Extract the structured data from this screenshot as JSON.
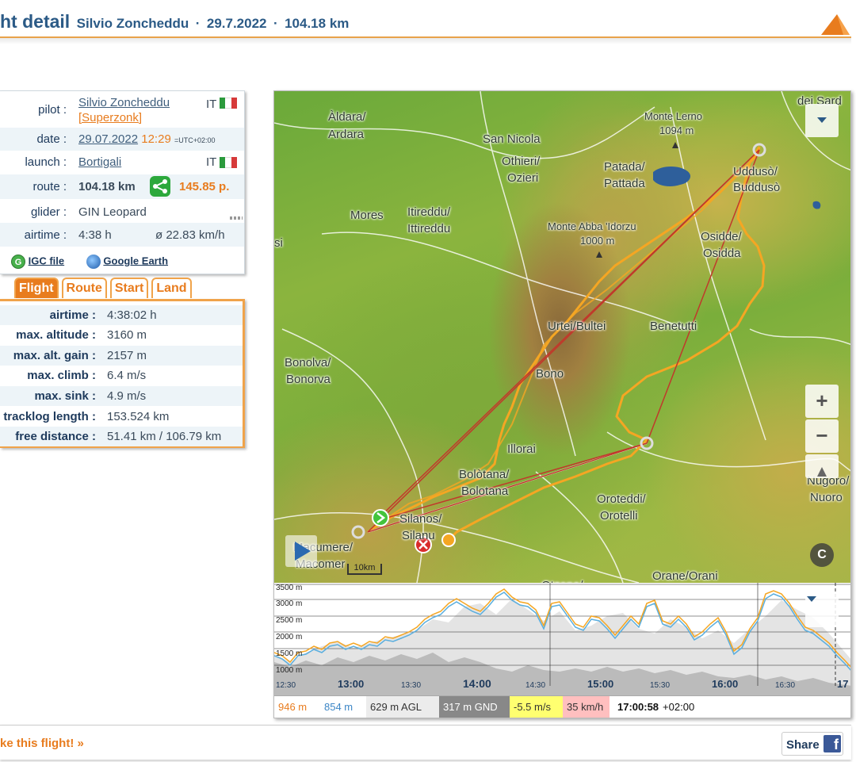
{
  "header": {
    "title": "ht detail",
    "pilot": "Silvio Zoncheddu",
    "date": "29.7.2022",
    "distance": "104.18 km",
    "sep": "·"
  },
  "info": {
    "pilot_label": "pilot :",
    "pilot_name": "Silvio Zoncheddu",
    "pilot_nick": "[Superzonk]",
    "country_code": "IT",
    "date_label": "date :",
    "date_value": "29.07.2022",
    "time_value": "12:29",
    "utc": "=UTC+02:00",
    "launch_label": "launch :",
    "launch_value": "Bortigali",
    "route_label": "route :",
    "route_km": "104.18 km",
    "route_points": "145.85 p.",
    "glider_label": "glider :",
    "glider_value": "GIN Leopard",
    "airtime_label": "airtime :",
    "airtime_value": "4:38 h",
    "avg_speed": "ø 22.83 km/h",
    "igc_file": "IGC file",
    "igc_icon": "G",
    "google_earth": "Google Earth"
  },
  "tabs": [
    "Flight",
    "Route",
    "Start",
    "Land"
  ],
  "stats": [
    {
      "label": "airtime :",
      "value": "4:38:02 h"
    },
    {
      "label": "max. altitude :",
      "value": "3160 m"
    },
    {
      "label": "max. alt. gain :",
      "value": "2157 m"
    },
    {
      "label": "max. climb :",
      "value": "6.4 m/s"
    },
    {
      "label": "max. sink :",
      "value": "4.9 m/s"
    },
    {
      "label": "tracklog length :",
      "value": "153.524 km"
    },
    {
      "label": "free distance :",
      "value": "51.41 km / 106.79 km"
    }
  ],
  "map": {
    "places": [
      "Àldara/",
      "Ardara",
      "San Nicola",
      "Monte Lerno",
      "1094 m",
      "dei Sard",
      "Othieri/",
      "Ozieri",
      "Patada/",
      "Pattada",
      "Uddusò/",
      "Buddusò",
      "Mores",
      "Itireddu/",
      "Ittireddu",
      "Monte Abba 'Idorzu",
      "1000 m",
      "Osidde/",
      "Osidda",
      "si",
      "Urtei/Bultei",
      "Benetutti",
      "Bonolva/",
      "Bonorva",
      "Bono",
      "Illorai",
      "Bolòtana/",
      "Bolotana",
      "Nùgoro/",
      "Nuoro",
      "Silanos/",
      "Silanu",
      "Oroteddi/",
      "Orotelli",
      "Macumere/",
      "Macomer",
      "Orane/Orani",
      "Otzana/"
    ],
    "scale": "10km",
    "zoom_in": "+",
    "zoom_out": "−",
    "copyright": "C"
  },
  "barogram": {
    "y_ticks": [
      "3500 m",
      "3000 m",
      "2500 m",
      "2000 m",
      "1500 m",
      "1000 m"
    ],
    "x_ticks": [
      "12:30",
      "13:00",
      "13:30",
      "14:00",
      "14:30",
      "15:00",
      "15:30",
      "16:00",
      "16:30",
      "17"
    ]
  },
  "legend": {
    "alt": "946 m",
    "alt2": "854 m",
    "agl": "629 m AGL",
    "gnd": "317 m GND",
    "vs": "-5.5 m/s",
    "speed": "35 km/h",
    "time": "17:00:58",
    "tz": "+02:00"
  },
  "footer": {
    "like": "ke this flight! »",
    "share": "Share",
    "fb": "f"
  },
  "colors": {
    "accent": "#e87c1e",
    "primary": "#2b5a86",
    "track": "#f5a623",
    "route": "#c0392b"
  }
}
